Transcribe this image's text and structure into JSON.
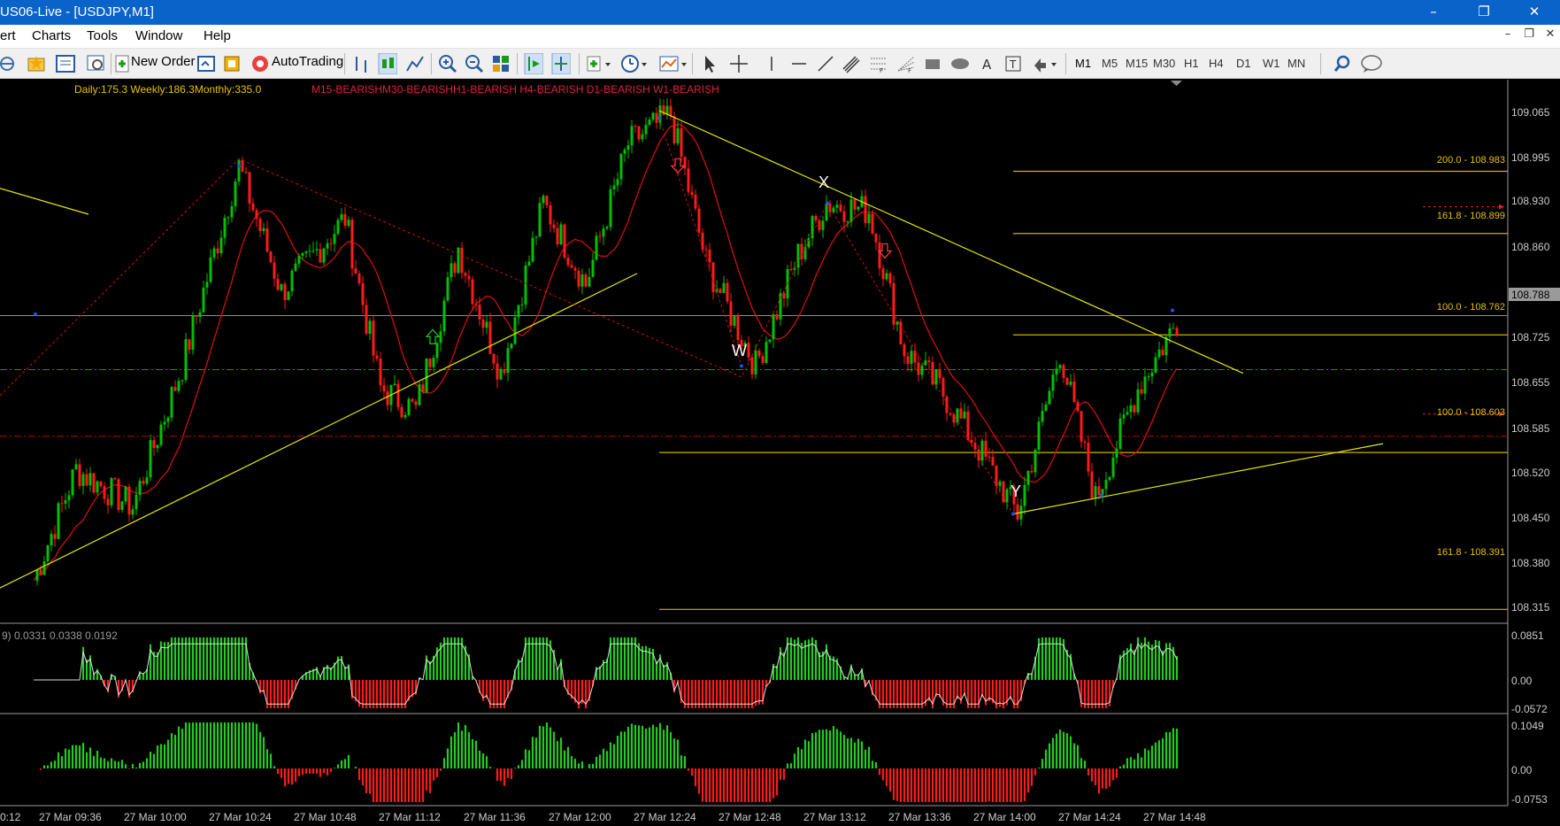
{
  "window": {
    "title": "US06-Live - [USDJPY,M1]",
    "minimize": "–",
    "restore": "❐",
    "close": "✕"
  },
  "menu": {
    "items": [
      "ert",
      "Charts",
      "Tools",
      "Window",
      "Help"
    ],
    "mdi_minimize": "–",
    "mdi_restore": "❐",
    "mdi_close": "✕"
  },
  "toolbar": {
    "new_order_label": "New Order",
    "autotrading_label": "AutoTrading",
    "timeframes": [
      "M1",
      "M5",
      "M15",
      "M30",
      "H1",
      "H4",
      "D1",
      "W1",
      "MN"
    ],
    "active_timeframe": "M1"
  },
  "chart": {
    "symbol": "USDJPY",
    "timeframe": "M1",
    "stats_text": "Daily:175.3 Weekly:186.3Monthly:335.0",
    "trend_text": "M15-BEARISHM30-BEARISHH1-BEARISH  H4-BEARISH  D1-BEARISH  W1-BEARISH",
    "current_price": "108.788",
    "price_ticks": [
      "109.065",
      "108.995",
      "108.930",
      "108.860",
      "108.788",
      "108.725",
      "108.655",
      "108.585",
      "108.520",
      "108.450",
      "108.380",
      "108.315"
    ],
    "fib_labels": [
      {
        "text": "200.0 - 108.983",
        "price": 108.983
      },
      {
        "text": "161.8 - 108.899",
        "price": 108.899
      },
      {
        "text": "100.0 - 108.762",
        "price": 108.762
      },
      {
        "text": "100.0 - 108.603",
        "price": 108.603
      },
      {
        "text": "161.8 - 108.391",
        "price": 108.391
      }
    ],
    "wave_labels": [
      "W",
      "X",
      "Y"
    ],
    "time_labels": [
      "0:12",
      "27 Mar 09:36",
      "27 Mar 10:00",
      "27 Mar 10:24",
      "27 Mar 10:48",
      "27 Mar 11:12",
      "27 Mar 11:36",
      "27 Mar 12:00",
      "27 Mar 12:24",
      "27 Mar 12:48",
      "27 Mar 13:12",
      "27 Mar 13:36",
      "27 Mar 14:00",
      "27 Mar 14:24",
      "27 Mar 14:48"
    ],
    "osc1_label": "9) 0.0331 0.0338 0.0192",
    "osc1_ticks": [
      "0.0851",
      "0.00",
      "-0.0572"
    ],
    "osc2_ticks": [
      "0.1049",
      "0.00",
      "-0.0753"
    ],
    "colors": {
      "bull_candle": "#00c000",
      "bear_candle": "#ff1a1a",
      "trendline": "#e6e600",
      "fib_line": "#d4b000",
      "ma_line": "#d01010",
      "grid_dash_green": "#00a000",
      "grid_dash_red": "#c00000",
      "price_box": "#9a9a9a",
      "osc_green": "#22cc22",
      "osc_red": "#ff1a1a"
    }
  },
  "chart_data": {
    "type": "candlestick",
    "symbol": "USDJPY",
    "timeframe": "M1",
    "ylim": [
      108.28,
      109.08
    ],
    "key_points": [
      {
        "time": "27 Mar 09:24",
        "close": 108.43
      },
      {
        "time": "27 Mar 09:36",
        "close": 108.58
      },
      {
        "time": "27 Mar 09:52",
        "close": 108.53
      },
      {
        "time": "27 Mar 10:06",
        "close": 108.72
      },
      {
        "time": "27 Mar 10:22",
        "close": 108.99
      },
      {
        "time": "27 Mar 10:34",
        "close": 108.82
      },
      {
        "time": "27 Mar 10:52",
        "close": 108.92
      },
      {
        "time": "27 Mar 11:02",
        "close": 108.69
      },
      {
        "time": "27 Mar 11:12",
        "close": 108.66
      },
      {
        "time": "27 Mar 11:24",
        "close": 108.88
      },
      {
        "time": "27 Mar 11:36",
        "close": 108.71
      },
      {
        "time": "27 Mar 11:48",
        "close": 108.94
      },
      {
        "time": "27 Mar 12:00",
        "close": 108.83
      },
      {
        "time": "27 Mar 12:12",
        "close": 109.02
      },
      {
        "time": "27 Mar 12:24",
        "close": 109.06
      },
      {
        "time": "27 Mar 12:34",
        "close": 108.86
      },
      {
        "time": "27 Mar 12:48",
        "close": 108.72
      },
      {
        "time": "27 Mar 13:00",
        "close": 108.87
      },
      {
        "time": "27 Mar 13:08",
        "close": 108.94
      },
      {
        "time": "27 Mar 13:20",
        "close": 108.93
      },
      {
        "time": "27 Mar 13:30",
        "close": 108.74
      },
      {
        "time": "27 Mar 13:40",
        "close": 108.69
      },
      {
        "time": "27 Mar 13:52",
        "close": 108.6
      },
      {
        "time": "27 Mar 14:02",
        "close": 108.52
      },
      {
        "time": "27 Mar 14:14",
        "close": 108.74
      },
      {
        "time": "27 Mar 14:24",
        "close": 108.54
      },
      {
        "time": "27 Mar 14:36",
        "close": 108.69
      },
      {
        "time": "27 Mar 14:48",
        "close": 108.788
      }
    ]
  }
}
